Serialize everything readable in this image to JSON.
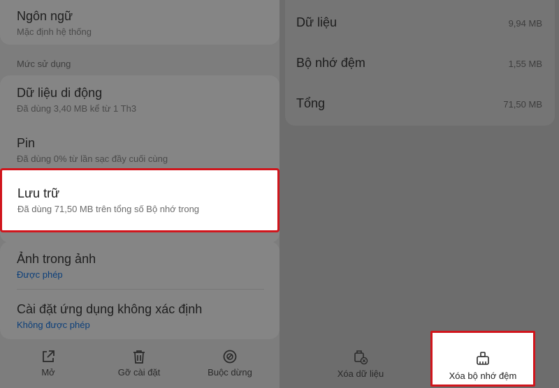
{
  "left": {
    "language": {
      "title": "Ngôn ngữ",
      "subtitle": "Mặc định hệ thống"
    },
    "usage_section": "Mức sử dụng",
    "mobile_data": {
      "title": "Dữ liệu di động",
      "subtitle": "Đã dùng 3,40 MB kể từ 1 Th3"
    },
    "battery": {
      "title": "Pin",
      "subtitle": "Đã dùng 0% từ lần sạc đầy cuối cùng"
    },
    "storage": {
      "title": "Lưu trữ",
      "subtitle": "Đã dùng 71,50 MB trên tổng số Bộ nhớ trong"
    },
    "pip": {
      "title": "Ảnh trong ảnh",
      "subtitle": "Được phép"
    },
    "unknown_apps": {
      "title": "Cài đặt ứng dụng không xác định",
      "subtitle": "Không được phép"
    },
    "actions": {
      "open": "Mở",
      "uninstall": "Gỡ cài đặt",
      "force_stop": "Buộc dừng"
    }
  },
  "right": {
    "data": {
      "label": "Dữ liệu",
      "value": "9,94 MB"
    },
    "cache": {
      "label": "Bộ nhớ đệm",
      "value": "1,55 MB"
    },
    "total": {
      "label": "Tổng",
      "value": "71,50 MB"
    },
    "actions": {
      "clear_data": "Xóa dữ liệu",
      "clear_cache": "Xóa bộ nhớ đệm"
    }
  },
  "colors": {
    "highlight_border": "#d0151c",
    "link": "#0c3f7a"
  },
  "icons": [
    "open-external-icon",
    "trash-icon",
    "block-icon",
    "clear-data-icon",
    "broom-icon"
  ]
}
